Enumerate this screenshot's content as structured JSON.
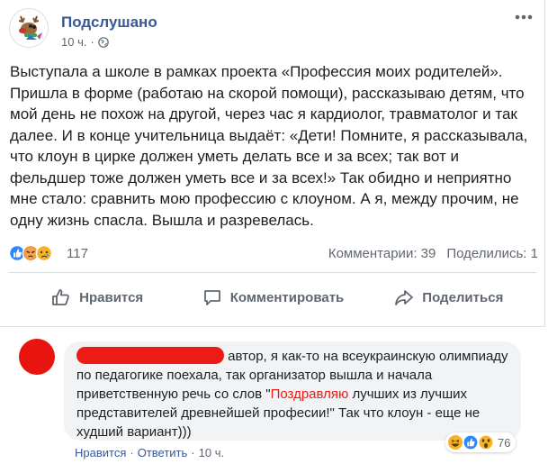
{
  "post": {
    "page_name": "Подслушано",
    "time": "10 ч.",
    "dot": "·",
    "text": "Выступала а школе в рамках проекта «Профессия моих родителей». Пришла в форме (работаю на скорой помощи), рассказываю детям, что мой день не похож на другой, через час я кардиолог, травматолог и так далее. И в конце учительница выдаёт: «Дети! Помните, я рассказывала, что клоун в цирке должен уметь делать все и за всех; так вот и фельдшер тоже должен уметь все и за всех!» Так обидно и неприятно мне стало: сравнить мою профессию с клоуном. А я, между прочим, не одну жизнь спасла. Вышла и разревелась.",
    "reactions_count": "117",
    "comments_label": "Комментарии: 39",
    "shares_label": "Поделились: 1",
    "reaction_icons": [
      "like-icon",
      "angry-icon",
      "sad-icon"
    ]
  },
  "actions": {
    "like": "Нравится",
    "comment": "Комментировать",
    "share": "Поделиться"
  },
  "comment": {
    "text_before": " автор, я как-то на всеукраинскую олимпиаду по педагогике поехала, так организатор вышла и начала приветственную речь со слов \"",
    "highlight": "Поздравляю",
    "text_after": " лучших из лучших представителей древнейшей професии!\" Так что клоун - еще не худший вариант)))",
    "reactions_count": "76",
    "reaction_icons": [
      "haha-icon",
      "like-icon",
      "wow-icon"
    ],
    "like_label": "Нравится",
    "reply_label": "Ответить",
    "time": "10 ч.",
    "sep": "·"
  },
  "colors": {
    "link_blue": "#365899",
    "redaction_red": "#ec1b13",
    "muted_gray": "#606770",
    "bubble_gray": "#f2f3f5"
  }
}
